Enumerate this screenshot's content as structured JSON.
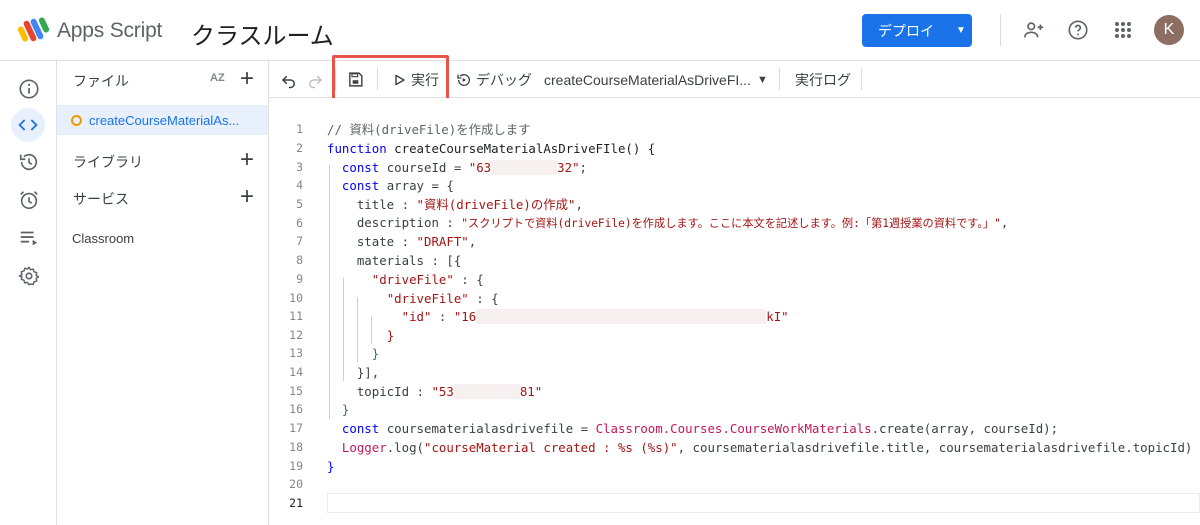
{
  "header": {
    "app_name": "Apps Script",
    "project_title": "クラスルーム",
    "deploy_label": "デプロイ",
    "avatar_initial": "K"
  },
  "files_panel": {
    "files_label": "ファイル",
    "sort_label": "AZ",
    "file_name": "createCourseMaterialAs...",
    "libraries_label": "ライブラリ",
    "services_label": "サービス",
    "service_item": "Classroom"
  },
  "toolbar": {
    "run_label": "実行",
    "debug_label": "デバッグ",
    "function_select": "createCourseMaterialAsDriveFI...",
    "exec_log_label": "実行ログ"
  },
  "code": {
    "line_numbers": [
      "1",
      "2",
      "3",
      "4",
      "5",
      "6",
      "7",
      "8",
      "9",
      "10",
      "11",
      "12",
      "13",
      "14",
      "15",
      "16",
      "17",
      "18",
      "19",
      "20",
      "21"
    ],
    "l1": "// 資料(driveFile)を作成します",
    "l2_kw": "function",
    "l2_rest": " createCourseMaterialAsDriveFIle() {",
    "l3_kw": "const",
    "l3_a": " courseId = ",
    "l3_s1": "\"63",
    "l3_s2": "32\"",
    "l3_b": ";",
    "l4_kw": "const",
    "l4_a": " array = {",
    "l5_a": "title : ",
    "l5_s": "\"資料(driveFile)の作成\"",
    "l5_b": ",",
    "l6_a": "description : ",
    "l6_s": "\"スクリプトで資料(driveFile)を作成します。ここに本文を記述します。例:「第1週授業の資料です。」\"",
    "l6_b": ",",
    "l7_a": "state : ",
    "l7_s": "\"DRAFT\"",
    "l7_b": ",",
    "l8_a": "materials : [{",
    "l9_s": "\"driveFile\"",
    "l9_b": " : {",
    "l10_s": "\"driveFile\"",
    "l10_b": " : {",
    "l11_s1": "\"id\"",
    "l11_b": " : ",
    "l11_s2": "\"16",
    "l11_s3": "kI\"",
    "l12": "}",
    "l13": "}",
    "l14": "}],",
    "l15_a": "topicId : ",
    "l15_s1": "\"53",
    "l15_s2": "81\"",
    "l16": "}",
    "l17_kw": "const",
    "l17_a": " coursematerialasdrivefile = ",
    "l17_cls": "Classroom.Courses.CourseWorkMaterials",
    "l17_b": ".create(array, courseId);",
    "l18_cls": "Logger",
    "l18_a": ".log(",
    "l18_s": "\"courseMaterial created : %s (%s)\"",
    "l18_b": ", coursematerialasdrivefile.title, coursematerialasdrivefile.topicId)",
    "l19": "}"
  },
  "colors": {
    "accent": "#1a73e8",
    "highlight_box": "#e8544a",
    "keyword": "#0000ff",
    "string": "#a31515"
  }
}
